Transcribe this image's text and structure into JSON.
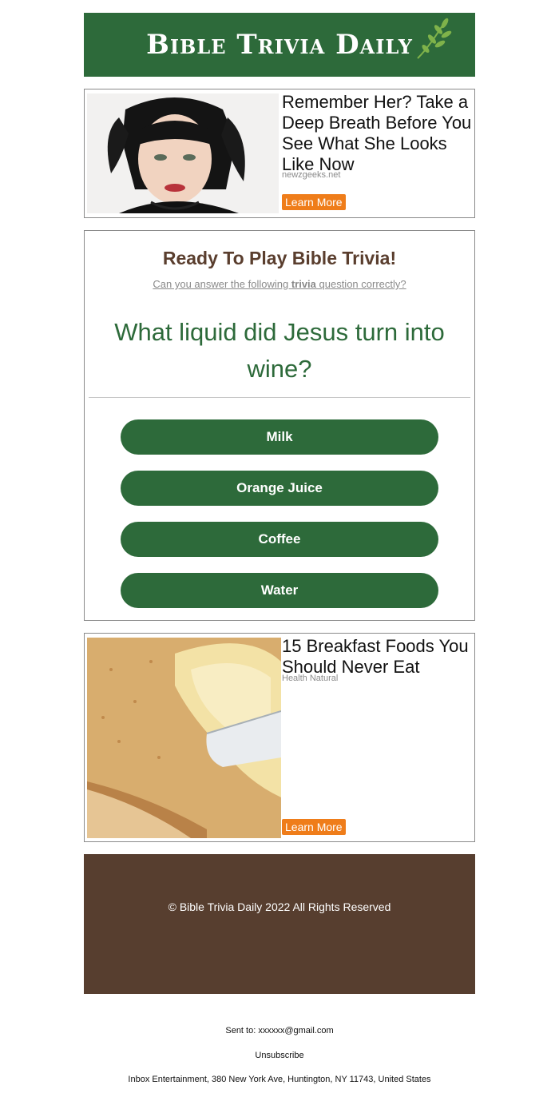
{
  "header": {
    "brand": "Bible Trivia Daily"
  },
  "ads": [
    {
      "title": "Remember Her? Take a Deep Breath Before You See What She Looks Like Now",
      "source": "newzgeeks.net",
      "cta": "Learn More"
    },
    {
      "title": "15 Breakfast Foods You Should Never Eat",
      "source": "Health Natural",
      "cta": "Learn More"
    }
  ],
  "trivia": {
    "heading": "Ready To Play Bible Trivia!",
    "subtitle_before": "Can you answer the following ",
    "subtitle_bold": "trivia",
    "subtitle_after": " question correctly?",
    "question": "What liquid did Jesus turn into wine?",
    "answers": [
      "Milk",
      "Orange Juice",
      "Coffee",
      "Water"
    ]
  },
  "footer": {
    "copyright": "© Bible Trivia Daily 2022 All Rights Reserved"
  },
  "meta": {
    "sent_to": "Sent to: xxxxxx@gmail.com",
    "unsubscribe": "Unsubscribe",
    "address": "Inbox Entertainment, 380 New York Ave, Huntington, NY 11743, United States"
  },
  "colors": {
    "brand_green": "#2d6a3a",
    "footer_brown": "#573e2f",
    "heading_brown": "#5a3e2e",
    "cta_orange": "#ef7d1a"
  }
}
